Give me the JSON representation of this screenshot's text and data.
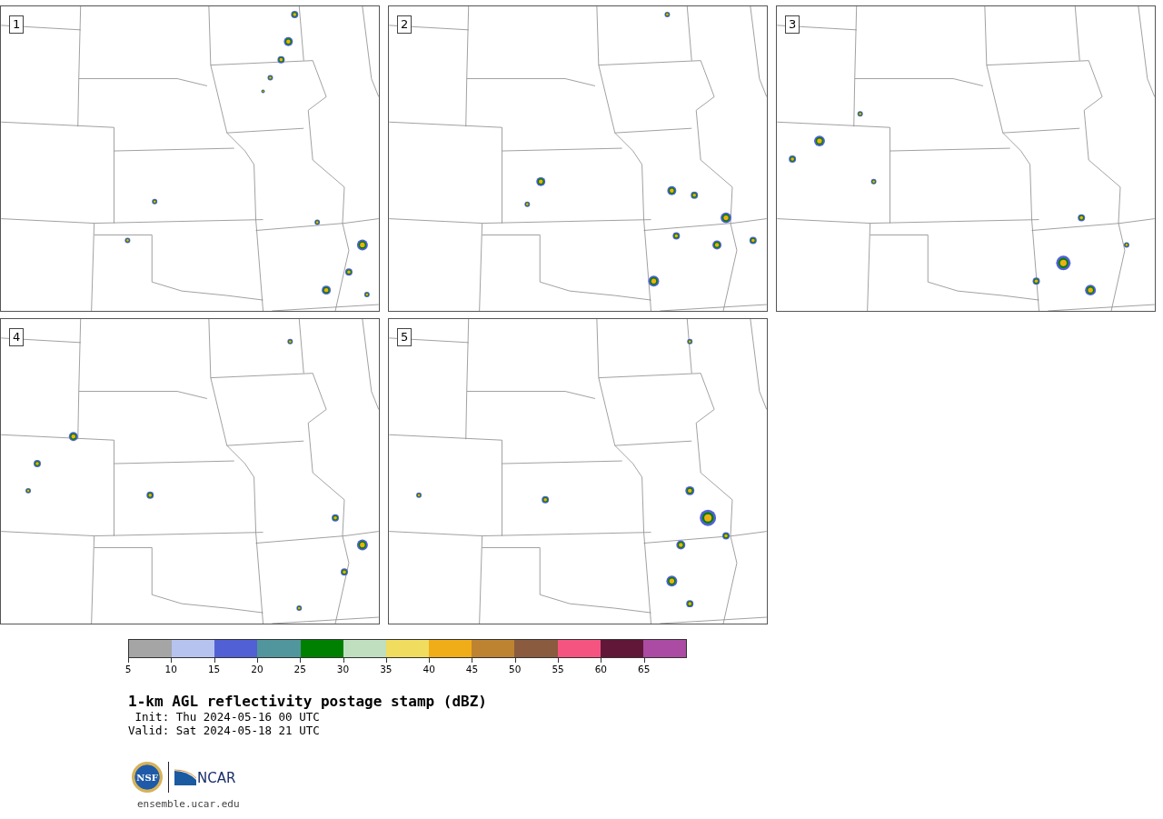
{
  "panels": [
    {
      "label": "1"
    },
    {
      "label": "2"
    },
    {
      "label": "3"
    },
    {
      "label": "4"
    },
    {
      "label": "5"
    }
  ],
  "colorbar": {
    "segments": [
      {
        "color": "#a5a5a5"
      },
      {
        "color": "#b7c3ef"
      },
      {
        "color": "#5260d6"
      },
      {
        "color": "#50969c"
      },
      {
        "color": "#008000"
      },
      {
        "color": "#c0dfbf"
      },
      {
        "color": "#f0dc5e"
      },
      {
        "color": "#f0ad17"
      },
      {
        "color": "#bd8331"
      },
      {
        "color": "#8a5b3e"
      },
      {
        "color": "#f55480"
      },
      {
        "color": "#611738"
      },
      {
        "color": "#ab4ba3"
      }
    ],
    "ticks": [
      "5",
      "10",
      "15",
      "20",
      "25",
      "30",
      "35",
      "40",
      "45",
      "50",
      "55",
      "60",
      "65"
    ]
  },
  "title": "1-km AGL reflectivity postage stamp (dBZ)",
  "init": " Init: Thu 2024-05-16 00 UTC",
  "valid": "Valid: Sat 2024-05-18 21 UTC",
  "logo": {
    "nsf": "NSF",
    "ncar": "NCAR"
  },
  "url": "ensemble.ucar.edu"
}
